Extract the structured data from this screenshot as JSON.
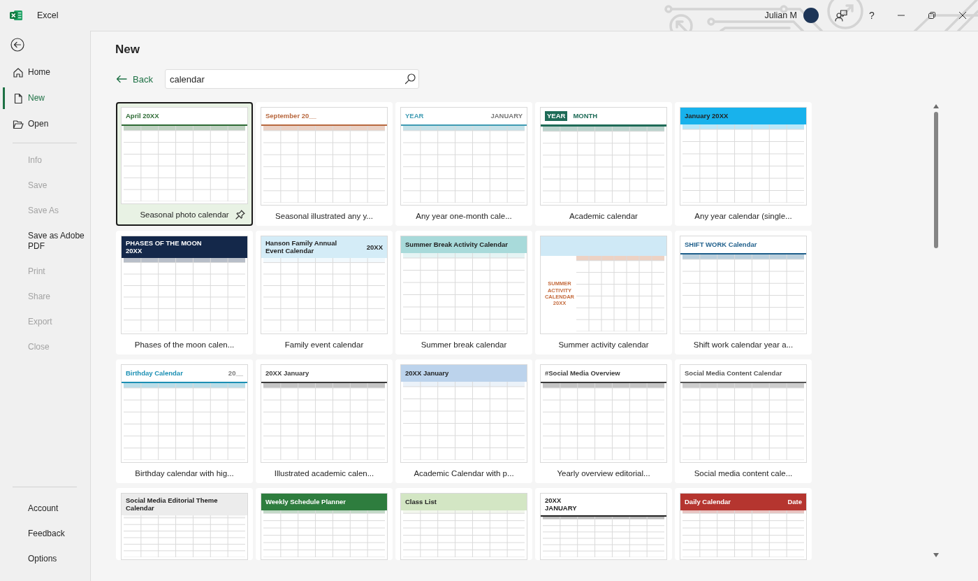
{
  "app": {
    "name": "Excel"
  },
  "title_bar": {
    "user_name": "Julian M",
    "help_label": "?"
  },
  "sidebar": {
    "sections": [
      {
        "items": [
          {
            "label": "Home",
            "selected": false,
            "disabled": false
          },
          {
            "label": "New",
            "selected": true,
            "disabled": false
          },
          {
            "label": "Open",
            "selected": false,
            "disabled": false
          }
        ]
      },
      {
        "items": [
          {
            "label": "Info",
            "selected": false,
            "disabled": true
          },
          {
            "label": "Save",
            "selected": false,
            "disabled": true
          },
          {
            "label": "Save As",
            "selected": false,
            "disabled": true
          },
          {
            "label": "Save as Adobe PDF",
            "selected": false,
            "disabled": false
          },
          {
            "label": "Print",
            "selected": false,
            "disabled": true
          },
          {
            "label": "Share",
            "selected": false,
            "disabled": true
          },
          {
            "label": "Export",
            "selected": false,
            "disabled": true
          },
          {
            "label": "Close",
            "selected": false,
            "disabled": true
          }
        ]
      },
      {
        "items": [
          {
            "label": "Account",
            "selected": false,
            "disabled": false
          },
          {
            "label": "Feedback",
            "selected": false,
            "disabled": false
          },
          {
            "label": "Options",
            "selected": false,
            "disabled": false
          }
        ]
      }
    ]
  },
  "page": {
    "title": "New",
    "back_label": "Back",
    "search": {
      "value": "calendar"
    },
    "templates": [
      {
        "name": "Seasonal photo calendar",
        "selected": true,
        "preview": {
          "kind": "plain",
          "color": "#2e6b35",
          "heading": [
            "April 20XX"
          ]
        }
      },
      {
        "name": "Seasonal illustrated any y...",
        "selected": false,
        "preview": {
          "kind": "plain",
          "color": "#b8683f",
          "heading": [
            "September 20__"
          ]
        }
      },
      {
        "name": "Any year one-month cale...",
        "selected": false,
        "preview": {
          "kind": "plain",
          "color": "#3f9bb3",
          "heading": [
            "YEAR"
          ],
          "aside": "JANUARY"
        }
      },
      {
        "name": "Academic calendar",
        "selected": false,
        "preview": {
          "kind": "badge",
          "color": "#1e6b57",
          "heading": [
            "YEAR"
          ],
          "aside": "MONTH"
        }
      },
      {
        "name": "Any year calendar (single...",
        "selected": false,
        "preview": {
          "kind": "banner",
          "color": "#18b2ec",
          "heading": [
            "January 20XX"
          ]
        }
      },
      {
        "name": "Phases of the moon calen...",
        "selected": false,
        "preview": {
          "kind": "banner",
          "color": "#14284a",
          "heading": [
            "PHASES OF THE MOON",
            "20XX"
          ]
        }
      },
      {
        "name": "Family event calendar",
        "selected": false,
        "preview": {
          "kind": "banner",
          "color": "#d4ecf7",
          "heading": [
            "Hanson Family Annual",
            "Event Calendar"
          ],
          "aside": "20XX"
        }
      },
      {
        "name": "Summer break calendar",
        "selected": false,
        "preview": {
          "kind": "banner",
          "color": "#a8dada",
          "heading": [
            "Summer Break Activity Calendar"
          ]
        }
      },
      {
        "name": "Summer activity calendar",
        "selected": false,
        "preview": {
          "kind": "side",
          "color": "#c46a3c",
          "heading": [
            "SUMMER",
            "ACTIVITY",
            "CALENDAR",
            "20XX"
          ]
        }
      },
      {
        "name": "Shift work calendar year a...",
        "selected": false,
        "preview": {
          "kind": "plain",
          "color": "#1f5f8b",
          "heading": [
            "SHIFT WORK Calendar"
          ]
        }
      },
      {
        "name": "Birthday calendar with hig...",
        "selected": false,
        "preview": {
          "kind": "plain",
          "color": "#1b8fb3",
          "heading": [
            "Birthday Calendar"
          ],
          "aside": "20__"
        }
      },
      {
        "name": "Illustrated academic calen...",
        "selected": false,
        "preview": {
          "kind": "plain",
          "color": "#3a3a3a",
          "heading": [
            "20XX January"
          ]
        }
      },
      {
        "name": "Academic Calendar with p...",
        "selected": false,
        "preview": {
          "kind": "banner",
          "color": "#bcd3ec",
          "heading": [
            "20XX January"
          ]
        }
      },
      {
        "name": "Yearly overview editorial...",
        "selected": false,
        "preview": {
          "kind": "plain",
          "color": "#3a3a3a",
          "heading": [
            "#Social Media Overview"
          ]
        }
      },
      {
        "name": "Social media content cale...",
        "selected": false,
        "preview": {
          "kind": "plain",
          "color": "#555555",
          "heading": [
            "Social Media Content Calendar"
          ]
        }
      },
      {
        "selected": false,
        "preview": {
          "kind": "banner",
          "color": "#ececec",
          "heading": [
            "Social Media Editorial Theme Calendar"
          ]
        }
      },
      {
        "selected": false,
        "preview": {
          "kind": "banner",
          "color": "#2e7d3e",
          "heading": [
            "Weekly Schedule Planner"
          ]
        }
      },
      {
        "selected": false,
        "preview": {
          "kind": "banner",
          "color": "#d3e6c4",
          "heading": [
            "Class List"
          ]
        }
      },
      {
        "selected": false,
        "preview": {
          "kind": "plain",
          "color": "#222222",
          "heading": [
            "20XX",
            "JANUARY"
          ]
        }
      },
      {
        "selected": false,
        "preview": {
          "kind": "banner",
          "color": "#b5352f",
          "heading": [
            "Daily Calendar"
          ],
          "aside": "Date"
        }
      }
    ]
  }
}
